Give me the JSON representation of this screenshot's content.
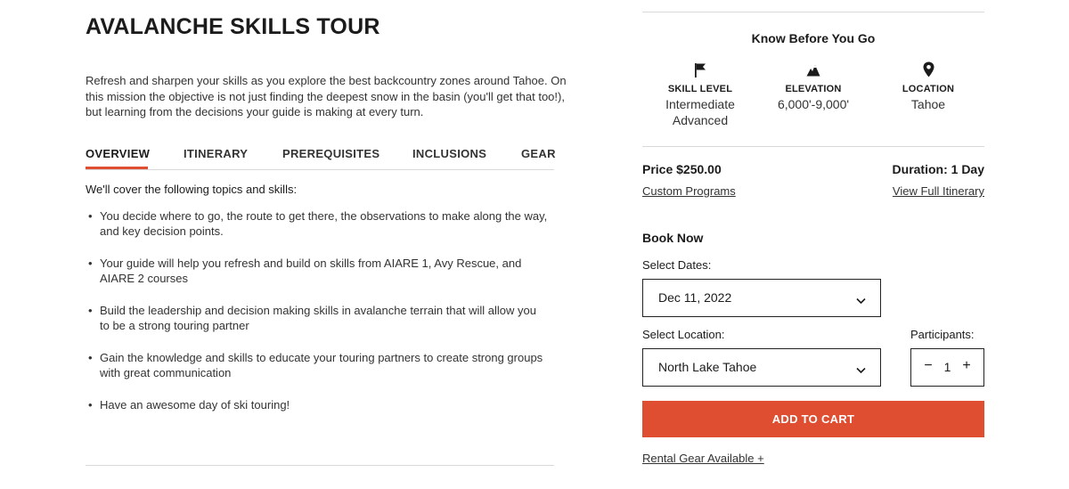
{
  "course": {
    "title": "AVALANCHE SKILLS TOUR",
    "intro": "Refresh and sharpen your skills as you explore the best backcountry zones around Tahoe. On this mission the objective is not just finding the deepest snow in the basin (you'll get that too!), but learning from the decisions your guide is making at every turn."
  },
  "tabs": [
    {
      "label": "OVERVIEW",
      "active": true
    },
    {
      "label": "ITINERARY",
      "active": false
    },
    {
      "label": "PREREQUISITES",
      "active": false
    },
    {
      "label": "INCLUSIONS",
      "active": false
    },
    {
      "label": "GEAR",
      "active": false
    }
  ],
  "overview": {
    "heading": "We'll cover the following topics and skills:",
    "bullets": [
      "You decide where to go, the route to get there, the observations to make along the way, and key decision points.",
      "Your guide will help you refresh and build on skills from AIARE 1, Avy Rescue, and AIARE 2 courses",
      "Build the leadership and decision making skills in avalanche terrain that will allow you to be a strong touring partner",
      "Gain the knowledge and skills to educate your touring partners to create strong groups with great communication",
      "Have an awesome day of ski touring!"
    ]
  },
  "know_before": {
    "title": "Know Before You Go",
    "stats": [
      {
        "icon": "flag-icon",
        "label": "SKILL LEVEL",
        "value_line1": "Intermediate",
        "value_line2": "Advanced"
      },
      {
        "icon": "mountain-icon",
        "label": "ELEVATION",
        "value_line1": "6,000'-9,000'",
        "value_line2": ""
      },
      {
        "icon": "location-pin-icon",
        "label": "LOCATION",
        "value_line1": "Tahoe",
        "value_line2": ""
      }
    ]
  },
  "pricing": {
    "price_label": "Price",
    "price_value": "$250.00",
    "duration_label": "Duration:",
    "duration_value": "1 Day",
    "custom_programs": "Custom Programs",
    "view_itinerary": "View Full Itinerary"
  },
  "booking": {
    "heading": "Book Now",
    "dates_label": "Select Dates:",
    "date_value": "Dec 11, 2022",
    "location_label": "Select Location:",
    "location_value": "North Lake Tahoe",
    "participants_label": "Participants:",
    "participants_value": "1",
    "minus": "−",
    "plus": "+",
    "add_to_cart": "ADD TO CART",
    "rental_gear": "Rental Gear Available +"
  },
  "colors": {
    "accent": "#e04e32",
    "text": "#1b1b1b",
    "rule": "#d9d9d9"
  }
}
